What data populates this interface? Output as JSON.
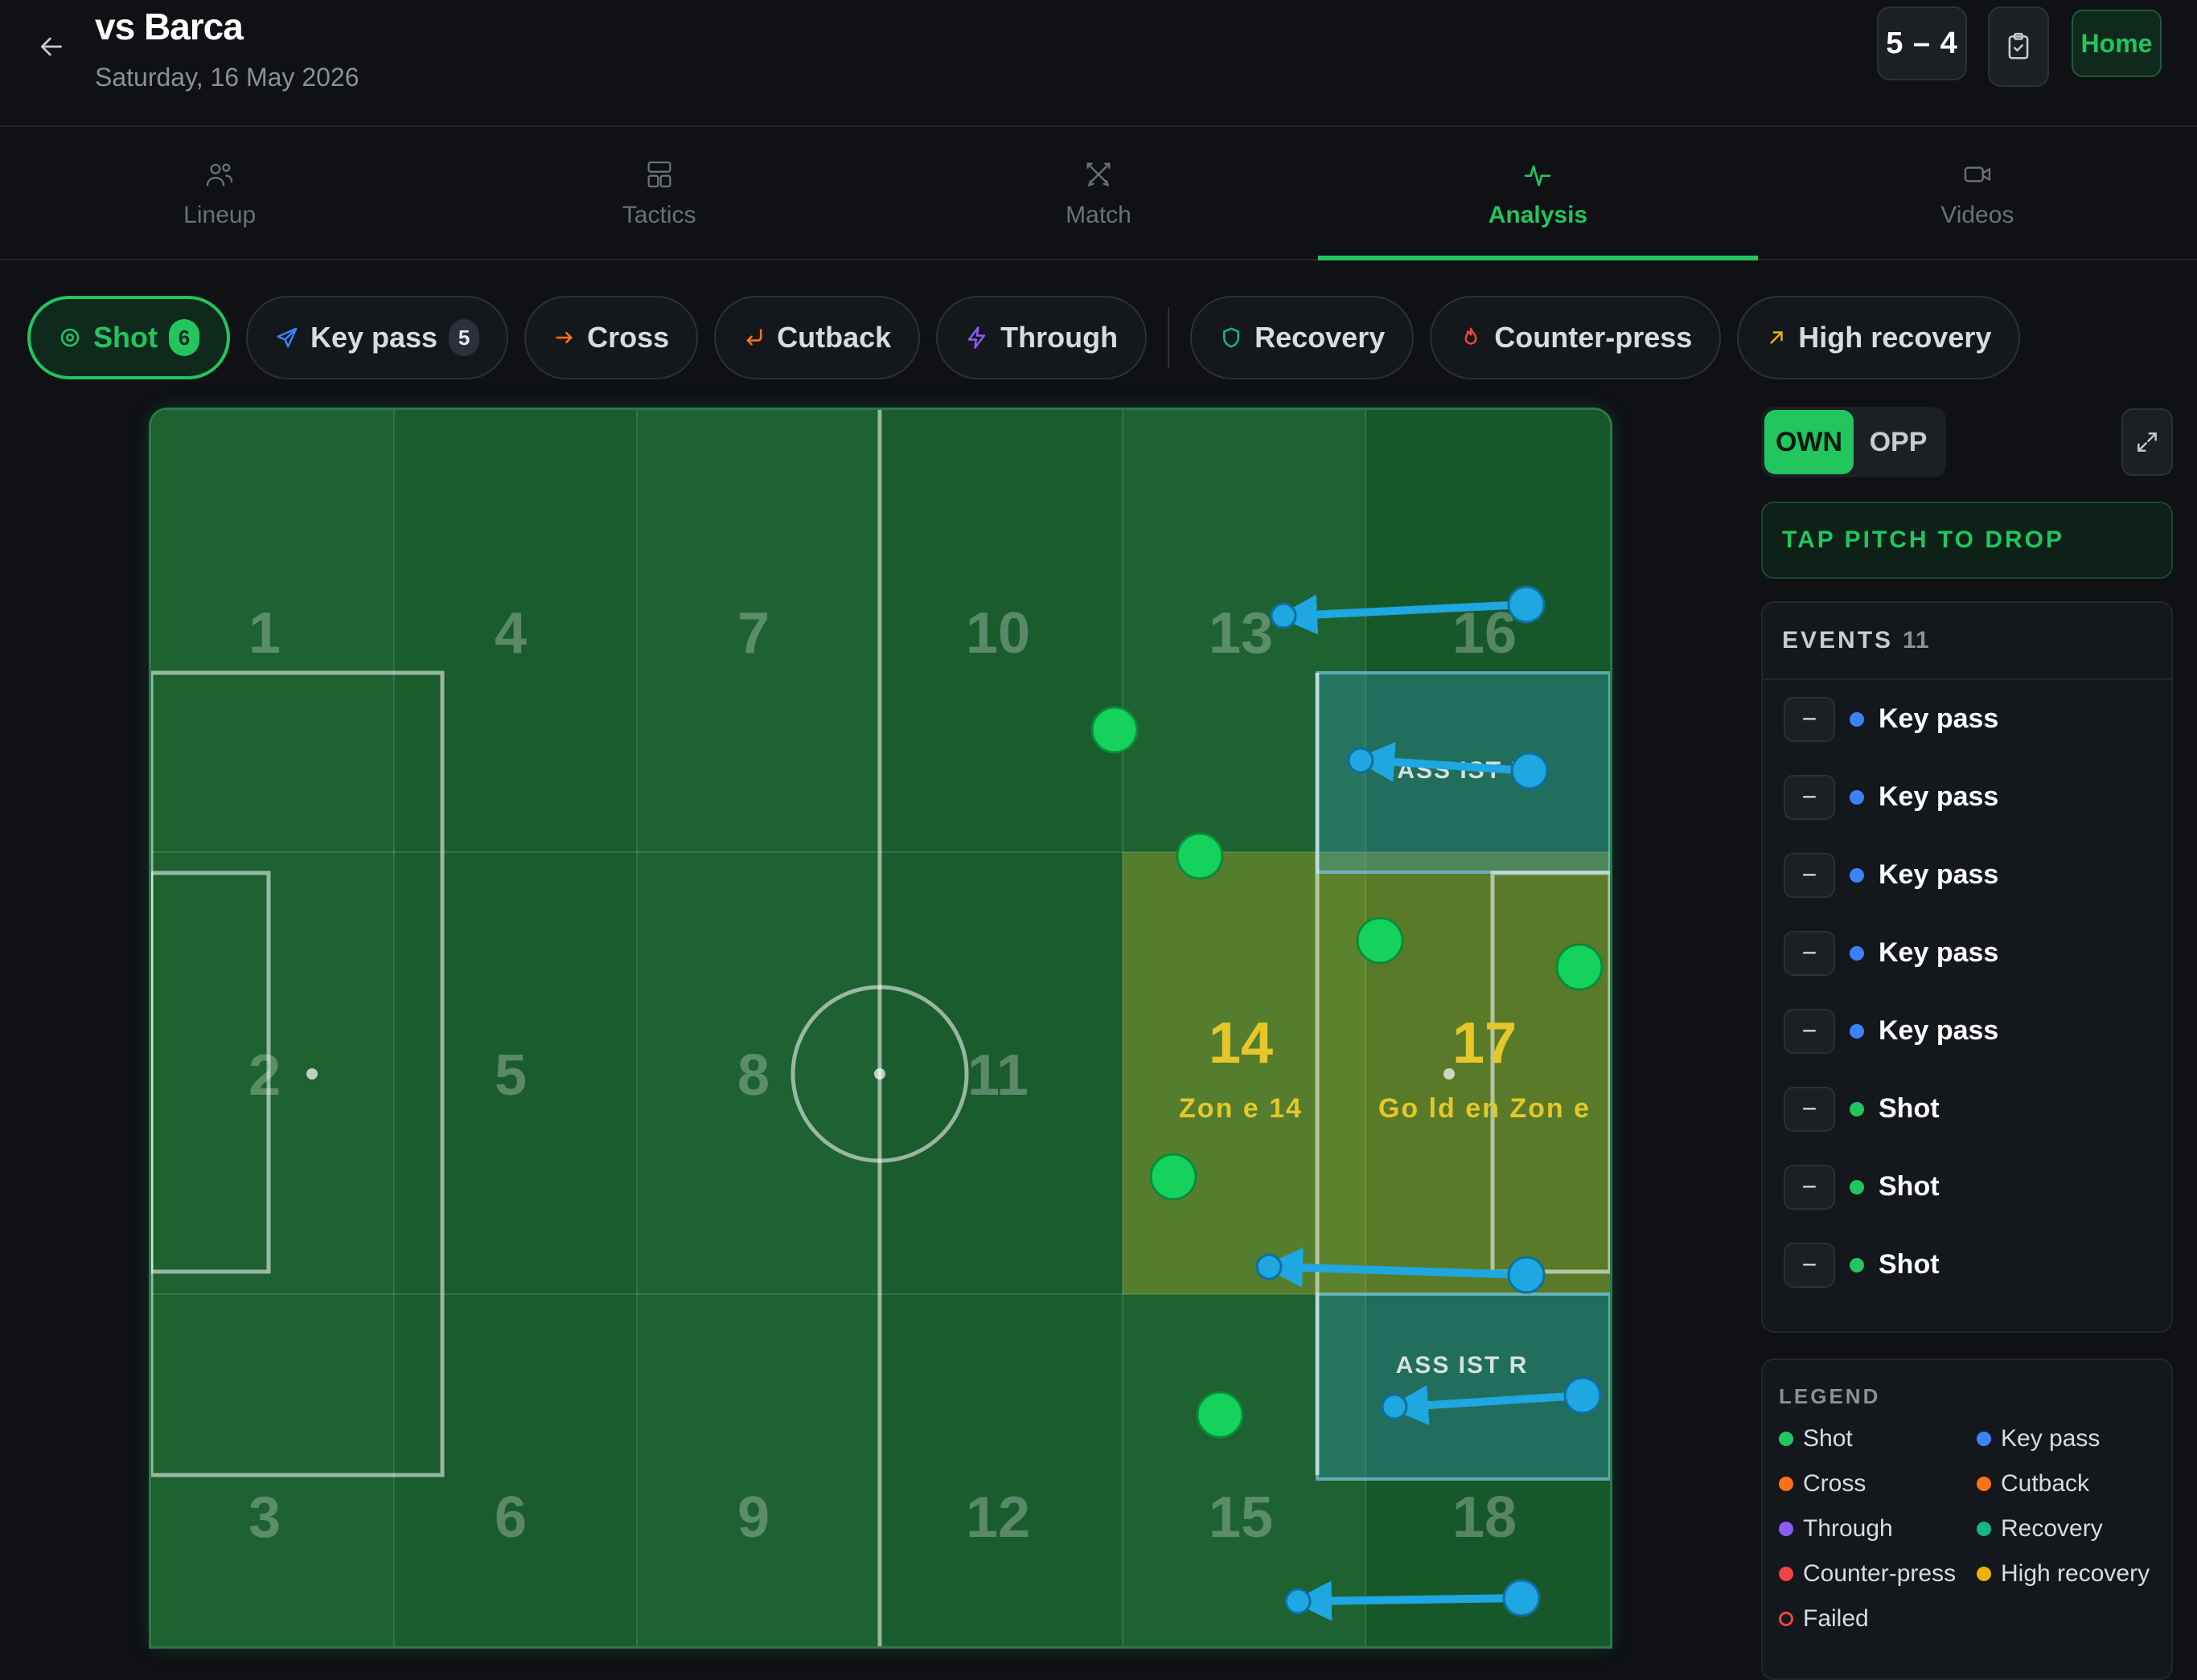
{
  "header": {
    "back_icon": "arrow-left-icon",
    "title": "vs Barca",
    "date": "Saturday, 16 May 2026",
    "score": "5 – 4",
    "clipboard_icon": "clipboard-check-icon",
    "venue": "Home"
  },
  "tabs": [
    {
      "label": "Lineup",
      "icon": "users-icon"
    },
    {
      "label": "Tactics",
      "icon": "layout-icon"
    },
    {
      "label": "Match",
      "icon": "swords-icon"
    },
    {
      "label": "Analysis",
      "icon": "activity-icon",
      "active": true
    },
    {
      "label": "Videos",
      "icon": "video-icon"
    }
  ],
  "filters": [
    {
      "label": "Shot",
      "count": "6",
      "active": true,
      "icon": "target-icon",
      "color": "#22c55e"
    },
    {
      "label": "Key pass",
      "count": "5",
      "icon": "send-icon",
      "color": "#3b82f6"
    },
    {
      "label": "Cross",
      "icon": "arrow-right-icon",
      "color": "#f97316"
    },
    {
      "label": "Cutback",
      "icon": "corner-down-left-icon",
      "color": "#f97316"
    },
    {
      "label": "Through",
      "icon": "zap-icon",
      "color": "#8b5cf6"
    },
    {
      "label": "Recovery",
      "icon": "shield-icon",
      "color": "#10b981"
    },
    {
      "label": "Counter-press",
      "icon": "flame-icon",
      "color": "#ef4444"
    },
    {
      "label": "High recovery",
      "icon": "arrow-up-right-icon",
      "color": "#eab308"
    }
  ],
  "pitch": {
    "zones": [
      "1",
      "4",
      "7",
      "10",
      "13",
      "16",
      "2",
      "5",
      "8",
      "11",
      "14",
      "17",
      "3",
      "6",
      "9",
      "12",
      "15",
      "18"
    ],
    "zone14_label": "Zon e 14",
    "golden_label": "Go ld en Zon e",
    "assist_left": "ASS IST L",
    "assist_right": "ASS IST R"
  },
  "side_toggle": {
    "own": "OWN",
    "opp": "OPP"
  },
  "expand_icon": "maximize-icon",
  "drop_banner": "TAP PITCH TO DROP",
  "events": {
    "title": "EVENTS",
    "count": "11",
    "items": [
      {
        "label": "Key pass",
        "color": "#3b82f6"
      },
      {
        "label": "Key pass",
        "color": "#3b82f6"
      },
      {
        "label": "Key pass",
        "color": "#3b82f6"
      },
      {
        "label": "Key pass",
        "color": "#3b82f6"
      },
      {
        "label": "Key pass",
        "color": "#3b82f6"
      },
      {
        "label": "Shot",
        "color": "#22c55e"
      },
      {
        "label": "Shot",
        "color": "#22c55e"
      },
      {
        "label": "Shot",
        "color": "#22c55e"
      }
    ]
  },
  "legend": {
    "title": "LEGEND",
    "items": [
      {
        "label": "Shot",
        "color": "#22c55e"
      },
      {
        "label": "Key pass",
        "color": "#3b82f6"
      },
      {
        "label": "Cross",
        "color": "#f97316"
      },
      {
        "label": "Cutback",
        "color": "#f97316"
      },
      {
        "label": "Through",
        "color": "#8b5cf6"
      },
      {
        "label": "Recovery",
        "color": "#10b981"
      },
      {
        "label": "Counter-press",
        "color": "#ef4444"
      },
      {
        "label": "High recovery",
        "color": "#eab308"
      },
      {
        "label": "Failed",
        "color": "#ef4444",
        "hollow": true
      }
    ]
  }
}
